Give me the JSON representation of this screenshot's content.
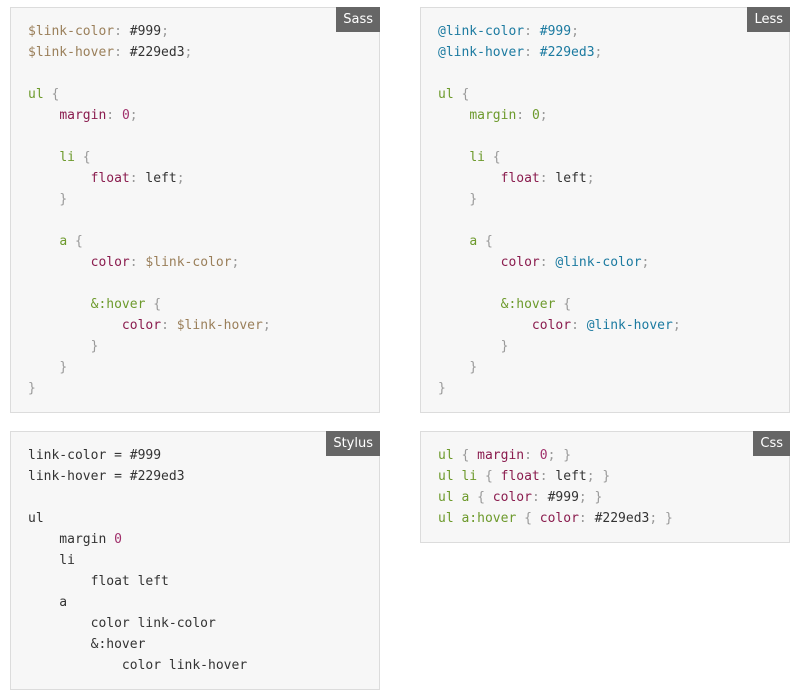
{
  "panels": [
    {
      "id": "sass",
      "badge": "Sass",
      "lines": [
        [
          [
            "var-sass",
            "$link-color"
          ],
          [
            "punc",
            ": "
          ],
          [
            "plain",
            "#999"
          ],
          [
            "punc",
            ";"
          ]
        ],
        [
          [
            "var-sass",
            "$link-hover"
          ],
          [
            "punc",
            ": "
          ],
          [
            "plain",
            "#229ed3"
          ],
          [
            "punc",
            ";"
          ]
        ],
        [],
        [
          [
            "sel",
            "ul"
          ],
          [
            "punc",
            " {"
          ]
        ],
        [
          [
            "plain",
            "    "
          ],
          [
            "prop",
            "margin"
          ],
          [
            "punc",
            ": "
          ],
          [
            "num",
            "0"
          ],
          [
            "punc",
            ";"
          ]
        ],
        [],
        [
          [
            "plain",
            "    "
          ],
          [
            "sel",
            "li"
          ],
          [
            "punc",
            " {"
          ]
        ],
        [
          [
            "plain",
            "        "
          ],
          [
            "prop",
            "float"
          ],
          [
            "punc",
            ": "
          ],
          [
            "plain",
            "left"
          ],
          [
            "punc",
            ";"
          ]
        ],
        [
          [
            "plain",
            "    "
          ],
          [
            "punc",
            "}"
          ]
        ],
        [],
        [
          [
            "plain",
            "    "
          ],
          [
            "sel",
            "a"
          ],
          [
            "punc",
            " {"
          ]
        ],
        [
          [
            "plain",
            "        "
          ],
          [
            "prop",
            "color"
          ],
          [
            "punc",
            ": "
          ],
          [
            "var-sass",
            "$link-color"
          ],
          [
            "punc",
            ";"
          ]
        ],
        [],
        [
          [
            "plain",
            "        "
          ],
          [
            "sel",
            "&:hover"
          ],
          [
            "punc",
            " {"
          ]
        ],
        [
          [
            "plain",
            "            "
          ],
          [
            "prop",
            "color"
          ],
          [
            "punc",
            ": "
          ],
          [
            "var-sass",
            "$link-hover"
          ],
          [
            "punc",
            ";"
          ]
        ],
        [
          [
            "plain",
            "        "
          ],
          [
            "punc",
            "}"
          ]
        ],
        [
          [
            "plain",
            "    "
          ],
          [
            "punc",
            "}"
          ]
        ],
        [
          [
            "punc",
            "}"
          ]
        ]
      ]
    },
    {
      "id": "less",
      "badge": "Less",
      "lines": [
        [
          [
            "var-less",
            "@link-color"
          ],
          [
            "punc",
            ": "
          ],
          [
            "var-less",
            "#999"
          ],
          [
            "punc",
            ";"
          ]
        ],
        [
          [
            "var-less",
            "@link-hover"
          ],
          [
            "punc",
            ": "
          ],
          [
            "var-less",
            "#229ed3"
          ],
          [
            "punc",
            ";"
          ]
        ],
        [],
        [
          [
            "sel",
            "ul"
          ],
          [
            "punc",
            " {"
          ]
        ],
        [
          [
            "plain",
            "    "
          ],
          [
            "sel",
            "margin"
          ],
          [
            "punc",
            ": "
          ],
          [
            "sel",
            "0"
          ],
          [
            "punc",
            ";"
          ]
        ],
        [],
        [
          [
            "plain",
            "    "
          ],
          [
            "sel",
            "li"
          ],
          [
            "punc",
            " {"
          ]
        ],
        [
          [
            "plain",
            "        "
          ],
          [
            "prop",
            "float"
          ],
          [
            "punc",
            ": "
          ],
          [
            "plain",
            "left"
          ],
          [
            "punc",
            ";"
          ]
        ],
        [
          [
            "plain",
            "    "
          ],
          [
            "punc",
            "}"
          ]
        ],
        [],
        [
          [
            "plain",
            "    "
          ],
          [
            "sel",
            "a"
          ],
          [
            "punc",
            " {"
          ]
        ],
        [
          [
            "plain",
            "        "
          ],
          [
            "prop",
            "color"
          ],
          [
            "punc",
            ": "
          ],
          [
            "var-less",
            "@link-color"
          ],
          [
            "punc",
            ";"
          ]
        ],
        [],
        [
          [
            "plain",
            "        "
          ],
          [
            "sel",
            "&:hover"
          ],
          [
            "punc",
            " {"
          ]
        ],
        [
          [
            "plain",
            "            "
          ],
          [
            "prop",
            "color"
          ],
          [
            "punc",
            ": "
          ],
          [
            "var-less",
            "@link-hover"
          ],
          [
            "punc",
            ";"
          ]
        ],
        [
          [
            "plain",
            "        "
          ],
          [
            "punc",
            "}"
          ]
        ],
        [
          [
            "plain",
            "    "
          ],
          [
            "punc",
            "}"
          ]
        ],
        [
          [
            "punc",
            "}"
          ]
        ]
      ]
    },
    {
      "id": "stylus",
      "badge": "Stylus",
      "lines": [
        [
          [
            "plain",
            "link-color = #999"
          ]
        ],
        [
          [
            "plain",
            "link-hover = #229ed3"
          ]
        ],
        [],
        [
          [
            "plain",
            "ul"
          ]
        ],
        [
          [
            "plain",
            "    margin "
          ],
          [
            "num",
            "0"
          ]
        ],
        [
          [
            "plain",
            "    li"
          ]
        ],
        [
          [
            "plain",
            "        float left"
          ]
        ],
        [
          [
            "plain",
            "    a"
          ]
        ],
        [
          [
            "plain",
            "        color link-color"
          ]
        ],
        [
          [
            "plain",
            "        &:hover"
          ]
        ],
        [
          [
            "plain",
            "            color link-hover"
          ]
        ]
      ]
    },
    {
      "id": "css",
      "badge": "Css",
      "lines": [
        [
          [
            "sel",
            "ul"
          ],
          [
            "punc",
            " { "
          ],
          [
            "prop",
            "margin"
          ],
          [
            "punc",
            ": "
          ],
          [
            "num",
            "0"
          ],
          [
            "punc",
            "; }"
          ]
        ],
        [
          [
            "sel",
            "ul li"
          ],
          [
            "punc",
            " { "
          ],
          [
            "prop",
            "float"
          ],
          [
            "punc",
            ": "
          ],
          [
            "plain",
            "left"
          ],
          [
            "punc",
            "; }"
          ]
        ],
        [
          [
            "sel",
            "ul a"
          ],
          [
            "punc",
            " { "
          ],
          [
            "prop",
            "color"
          ],
          [
            "punc",
            ": "
          ],
          [
            "plain",
            "#999"
          ],
          [
            "punc",
            "; }"
          ]
        ],
        [
          [
            "sel",
            "ul a:hover"
          ],
          [
            "punc",
            " { "
          ],
          [
            "prop",
            "color"
          ],
          [
            "punc",
            ": "
          ],
          [
            "plain",
            "#229ed3"
          ],
          [
            "punc",
            "; }"
          ]
        ]
      ]
    }
  ]
}
